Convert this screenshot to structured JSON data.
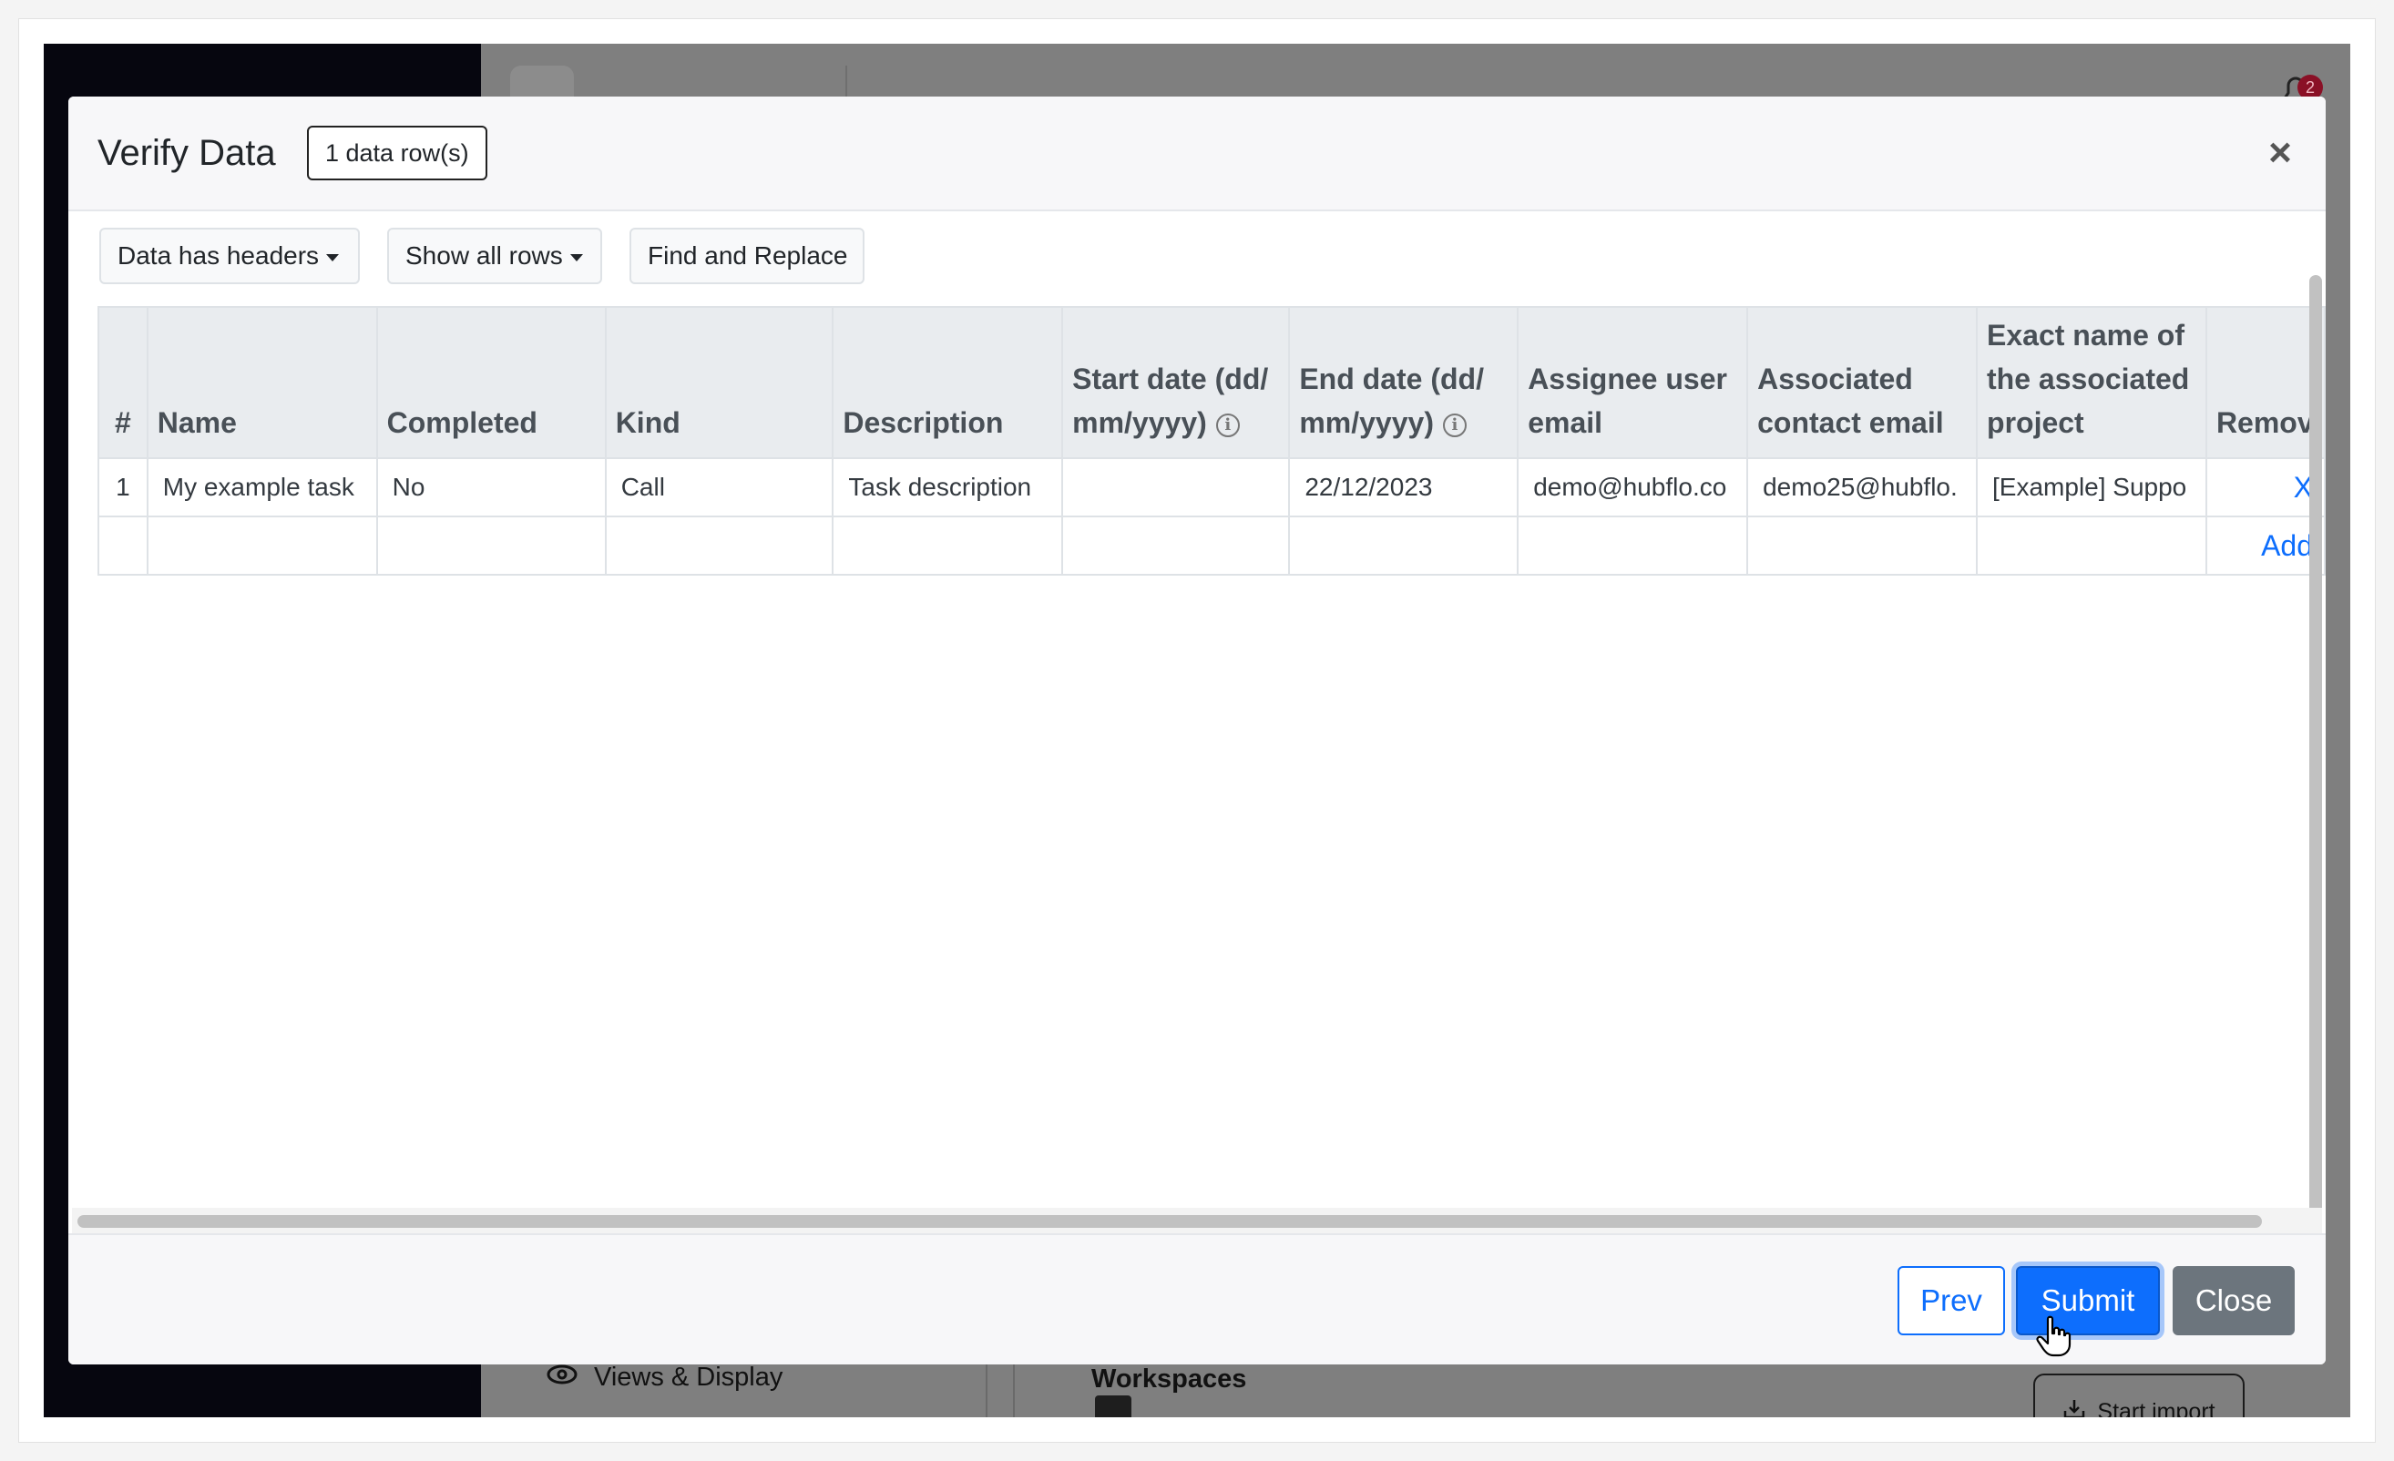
{
  "background_app": {
    "notification_count": "2",
    "views_display_label": "Views & Display",
    "workspaces_label": "Workspaces",
    "start_import_label": "Start import"
  },
  "modal": {
    "title": "Verify Data",
    "rows_badge": "1 data row(s)",
    "close_symbol": "×",
    "toolbar": {
      "headers_dropdown": "Data has headers",
      "rows_dropdown": "Show all rows",
      "find_replace": "Find and Replace"
    },
    "table": {
      "columns": [
        {
          "label": "#"
        },
        {
          "label": "Name"
        },
        {
          "label": "Completed"
        },
        {
          "label": "Kind"
        },
        {
          "label": "Description"
        },
        {
          "label": "Start date (dd/mm/yyyy)",
          "info": true
        },
        {
          "label": "End date (dd/mm/yyyy)",
          "info": true
        },
        {
          "label": "Assignee user email"
        },
        {
          "label": "Associated contact email"
        },
        {
          "label": "Exact name of the associated project"
        },
        {
          "label": "Remov"
        }
      ],
      "rows": [
        {
          "num": "1",
          "name": "My example task",
          "completed": "No",
          "kind": "Call",
          "description": "Task description",
          "start_date": "",
          "end_date": "22/12/2023",
          "assignee_email": "demo@hubflo.co",
          "contact_email": "demo25@hubflo.",
          "project": "[Example] Suppo",
          "remove": "X"
        }
      ],
      "add_label": "Add"
    },
    "footer": {
      "prev": "Prev",
      "submit": "Submit",
      "close": "Close"
    }
  },
  "colors": {
    "primary": "#0d6efd",
    "secondary": "#6c757d",
    "overlay": "#7f7f7f",
    "sidebar": "#06060f"
  }
}
